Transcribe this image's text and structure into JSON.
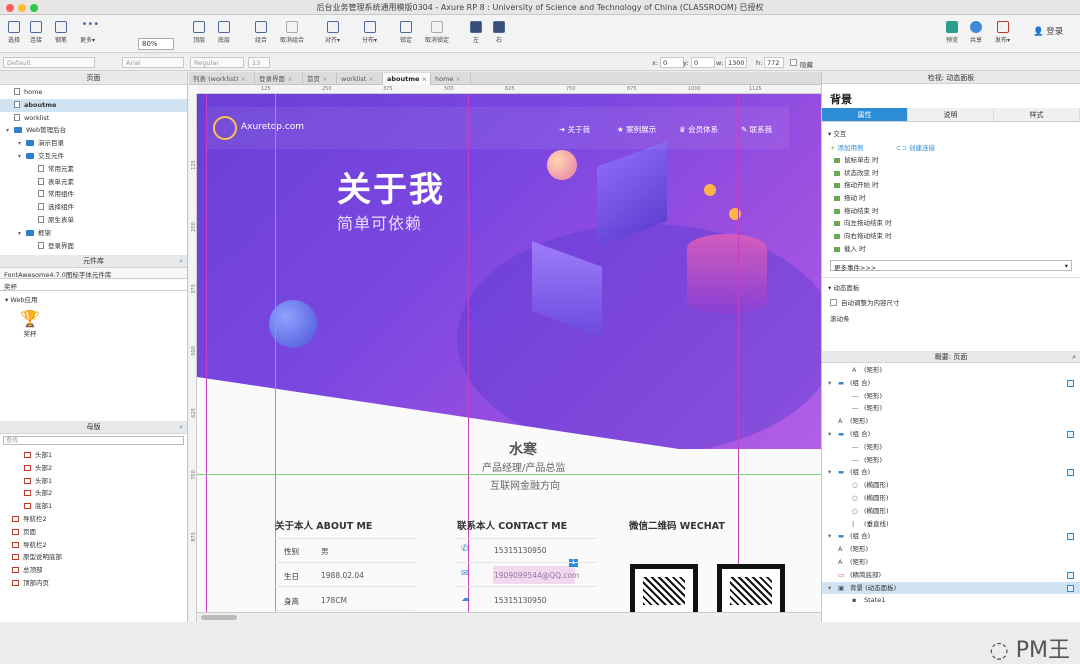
{
  "window": {
    "title": "后台业务管理系统通用模版0304 - Axure RP 8 : University of Science and Technology of China (CLASSROOM) 已授权"
  },
  "toolbar": {
    "select": "选择",
    "connect": "连接",
    "pen": "钢笔",
    "more": "更多▾",
    "zoom": "80%",
    "zoom_label": "缩放",
    "top": "顶层",
    "bottom": "底层",
    "group": "组合",
    "ungroup": "取消组合",
    "align": "对齐▾",
    "distribute": "分布▾",
    "lock": "锁定",
    "unlock": "取消锁定",
    "left": "左",
    "right": "右",
    "preview": "预览",
    "share": "共享",
    "publish": "发布▾",
    "login": "登录"
  },
  "propbar": {
    "style": "Default",
    "font": "Arial",
    "weight": "Regular",
    "size": "13",
    "x_label": "x:",
    "x": "0",
    "y_label": "y:",
    "y": "0",
    "w_label": "w:",
    "w": "1300",
    "h_label": "h:",
    "h": "772",
    "hidden": "隐藏"
  },
  "pages_panel": {
    "title": "页面",
    "items": [
      {
        "label": "home",
        "indent": 0
      },
      {
        "label": "aboutme",
        "indent": 0,
        "selected": true
      },
      {
        "label": "worklist",
        "indent": 0
      },
      {
        "label": "Web管理后台",
        "indent": 0,
        "folder": true
      },
      {
        "label": "演示目录",
        "indent": 1,
        "folder": true
      },
      {
        "label": "交互元件",
        "indent": 1,
        "folder": true
      },
      {
        "label": "常用元素",
        "indent": 2
      },
      {
        "label": "表单元素",
        "indent": 2
      },
      {
        "label": "常用组件",
        "indent": 2
      },
      {
        "label": "选择组件",
        "indent": 2
      },
      {
        "label": "原生表单",
        "indent": 2
      },
      {
        "label": "框架",
        "indent": 1,
        "folder": true
      },
      {
        "label": "登录界面",
        "indent": 2
      }
    ]
  },
  "widgets_panel": {
    "title": "元件库",
    "library": "FontAwesome4.7.0图标字体元件库",
    "search": "奖杯",
    "group": "Web应用",
    "item": "奖杯"
  },
  "masters_panel": {
    "title": "母版",
    "search_placeholder": "查找",
    "items": [
      {
        "label": "头部1",
        "indent": 1
      },
      {
        "label": "头部2",
        "indent": 1
      },
      {
        "label": "头部1",
        "indent": 1
      },
      {
        "label": "头部2",
        "indent": 1
      },
      {
        "label": "底部1",
        "indent": 1
      },
      {
        "label": "导航栏2",
        "indent": 0
      },
      {
        "label": "页面",
        "indent": 0
      },
      {
        "label": "导航栏2",
        "indent": 0
      },
      {
        "label": "原型说明底部",
        "indent": 0
      },
      {
        "label": "总顶部",
        "indent": 0
      },
      {
        "label": "顶部内页",
        "indent": 0
      }
    ]
  },
  "tabs": [
    {
      "label": "列表 (worklist)"
    },
    {
      "label": "登录界面"
    },
    {
      "label": "首页"
    },
    {
      "label": "worklist"
    },
    {
      "label": "aboutme",
      "active": true
    },
    {
      "label": "home"
    }
  ],
  "ruler_h": [
    "125",
    "250",
    "375",
    "500",
    "625",
    "750",
    "875",
    "1000",
    "1125"
  ],
  "ruler_v": [
    "125",
    "250",
    "375",
    "500",
    "625",
    "750",
    "875"
  ],
  "page": {
    "logo": "Axuretop.com",
    "nav": [
      "关于我",
      "案例展示",
      "会员体系",
      "联系我"
    ],
    "hero_title": "关于我",
    "hero_subtitle": "简单可依赖",
    "name": "水寒",
    "role": "产品经理/产品总监",
    "focus": "互联网金融方向",
    "about_title": "关于本人 ABOUT ME",
    "about_rows": [
      {
        "label": "性别",
        "value": "男"
      },
      {
        "label": "生日",
        "value": "1988.02.04"
      },
      {
        "label": "身高",
        "value": "178CM"
      }
    ],
    "contact_title": "联系本人 CONTACT ME",
    "contact_rows": [
      "15315130950",
      "1909099544@QQ.com",
      "15315130950"
    ],
    "contact_badge": "1",
    "wechat_title": "微信二维码 WECHAT"
  },
  "inspector": {
    "header": "检视: 动态面板",
    "name": "背景",
    "tabs": [
      "属性",
      "说明",
      "样式"
    ],
    "section_interaction": "交互",
    "add_case": "添加用例",
    "create_link": "创建连接",
    "events": [
      "鼠标单击 时",
      "状态改变 时",
      "拖动开始 时",
      "拖动 时",
      "拖动结束 时",
      "向左拖动结束 时",
      "向右拖动结束 时",
      "载入 时"
    ],
    "more_events": "更多事件>>>",
    "section_dynamic": "动态面板",
    "fit_content": "自动调整为内容尺寸",
    "scrollbar": "滚动条"
  },
  "outline": {
    "header": "概要: 页面",
    "items": [
      {
        "label": "(矩形)",
        "indent": 1,
        "type": "text"
      },
      {
        "label": "(组 合)",
        "indent": 0,
        "type": "group",
        "check": true
      },
      {
        "label": "(矩形)",
        "indent": 1,
        "type": "line"
      },
      {
        "label": "(矩形)",
        "indent": 1,
        "type": "line"
      },
      {
        "label": "(矩形)",
        "indent": 0,
        "type": "text"
      },
      {
        "label": "(组 合)",
        "indent": 0,
        "type": "group",
        "check": true
      },
      {
        "label": "(矩形)",
        "indent": 1,
        "type": "line"
      },
      {
        "label": "(矩形)",
        "indent": 1,
        "type": "line"
      },
      {
        "label": "(组 合)",
        "indent": 0,
        "type": "group",
        "check": true
      },
      {
        "label": "(椭圆形)",
        "indent": 1,
        "type": "circle"
      },
      {
        "label": "(椭圆形)",
        "indent": 1,
        "type": "circle"
      },
      {
        "label": "(椭圆形)",
        "indent": 1,
        "type": "circle"
      },
      {
        "label": "(垂直线)",
        "indent": 1,
        "type": "vline"
      },
      {
        "label": "(组 合)",
        "indent": 0,
        "type": "group",
        "check": true
      },
      {
        "label": "(矩形)",
        "indent": 0,
        "type": "text"
      },
      {
        "label": "(矩形)",
        "indent": 0,
        "type": "text"
      },
      {
        "label": "(精简底部)",
        "indent": 0,
        "type": "master",
        "check": true
      },
      {
        "label": "背景 (动态面板)",
        "indent": 0,
        "type": "panel",
        "check": true,
        "selected": true
      },
      {
        "label": "State1",
        "indent": 1,
        "type": "state"
      }
    ]
  },
  "watermark": "PM王",
  "colors": {
    "accent": "#2d8cd6",
    "hero_start": "#6a3fd8",
    "hero_end": "#b15fe6"
  }
}
